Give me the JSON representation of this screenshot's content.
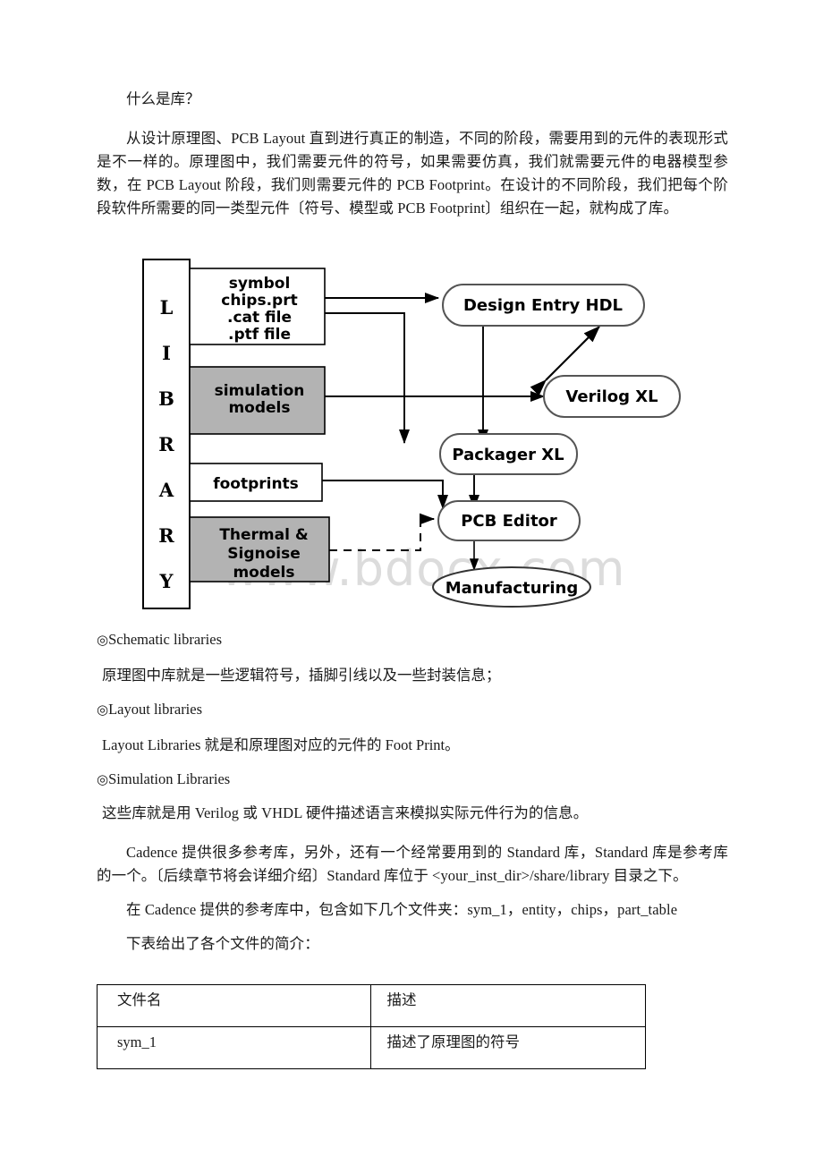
{
  "document": {
    "heading": "什么是库？",
    "intro_paragraph": "从设计原理图、PCB Layout 直到进行真正的制造，不同的阶段，需要用到的元件的表现形式是不一样的。原理图中，我们需要元件的符号，如果需要仿真，我们就需要元件的电器模型参数，在 PCB Layout 阶段，我们则需要元件的 PCB Footprint。在设计的不同阶段，我们把每个阶段软件所需要的同一类型元件〔符号、模型或 PCB Footprint〕组织在一起，就构成了库。",
    "sections": [
      {
        "bullet": "◎",
        "title": "Schematic libraries",
        "body": "原理图中库就是一些逻辑符号，插脚引线以及一些封装信息；"
      },
      {
        "bullet": "◎",
        "title": "Layout libraries",
        "body": "Layout Libraries 就是和原理图对应的元件的 Foot Print。"
      },
      {
        "bullet": "◎",
        "title": "Simulation Libraries",
        "body": "这些库就是用 Verilog 或 VHDL 硬件描述语言来模拟实际元件行为的信息。"
      }
    ],
    "paragraph_cadence": "Cadence 提供很多参考库，另外，还有一个经常要用到的 Standard 库，Standard 库是参考库的一个。〔后续章节将会详细介绍〕Standard 库位于 <your_inst_dir>/share/library 目录之下。",
    "paragraph_folders": "在 Cadence 提供的参考库中，包含如下几个文件夹：sym_1，entity，chips，part_table",
    "table_intro": "下表给出了各个文件的简介："
  },
  "diagram": {
    "library_label_letters": "LIBRARY",
    "library_letters": [
      "L",
      "I",
      "B",
      "R",
      "A",
      "R",
      "Y"
    ],
    "boxes": [
      {
        "id": "symbol-box",
        "label": "symbol\nchips.prt\n.cat file\n.ptf file",
        "lines": [
          "symbol",
          "chips.prt",
          ".cat file",
          ".ptf file"
        ],
        "fill": "#ffffff"
      },
      {
        "id": "simulation-models-box",
        "label": "simulation models",
        "lines": [
          "simulation",
          "models"
        ],
        "fill": "#b3b3b3"
      },
      {
        "id": "footprints-box",
        "label": "footprints",
        "lines": [
          "footprints"
        ],
        "fill": "#ffffff"
      },
      {
        "id": "thermal-signoise-box",
        "label": "Thermal & Signoise models",
        "lines": [
          "Thermal &",
          "Signoise",
          "models"
        ],
        "fill": "#b3b3b3"
      }
    ],
    "nodes": [
      {
        "id": "design-entry-hdl",
        "label": "Design Entry HDL",
        "shape": "rounded"
      },
      {
        "id": "verilog-xl",
        "label": "Verilog XL",
        "shape": "rounded"
      },
      {
        "id": "packager-xl",
        "label": "Packager XL",
        "shape": "rounded"
      },
      {
        "id": "pcb-editor",
        "label": "PCB Editor",
        "shape": "rounded"
      },
      {
        "id": "manufacturing",
        "label": "Manufacturing",
        "shape": "ellipse"
      }
    ],
    "watermark": "www.bdocx.com"
  },
  "table": {
    "headers": [
      "文件名",
      "描述"
    ],
    "rows": [
      [
        "sym_1",
        "描述了原理图的符号"
      ]
    ]
  }
}
